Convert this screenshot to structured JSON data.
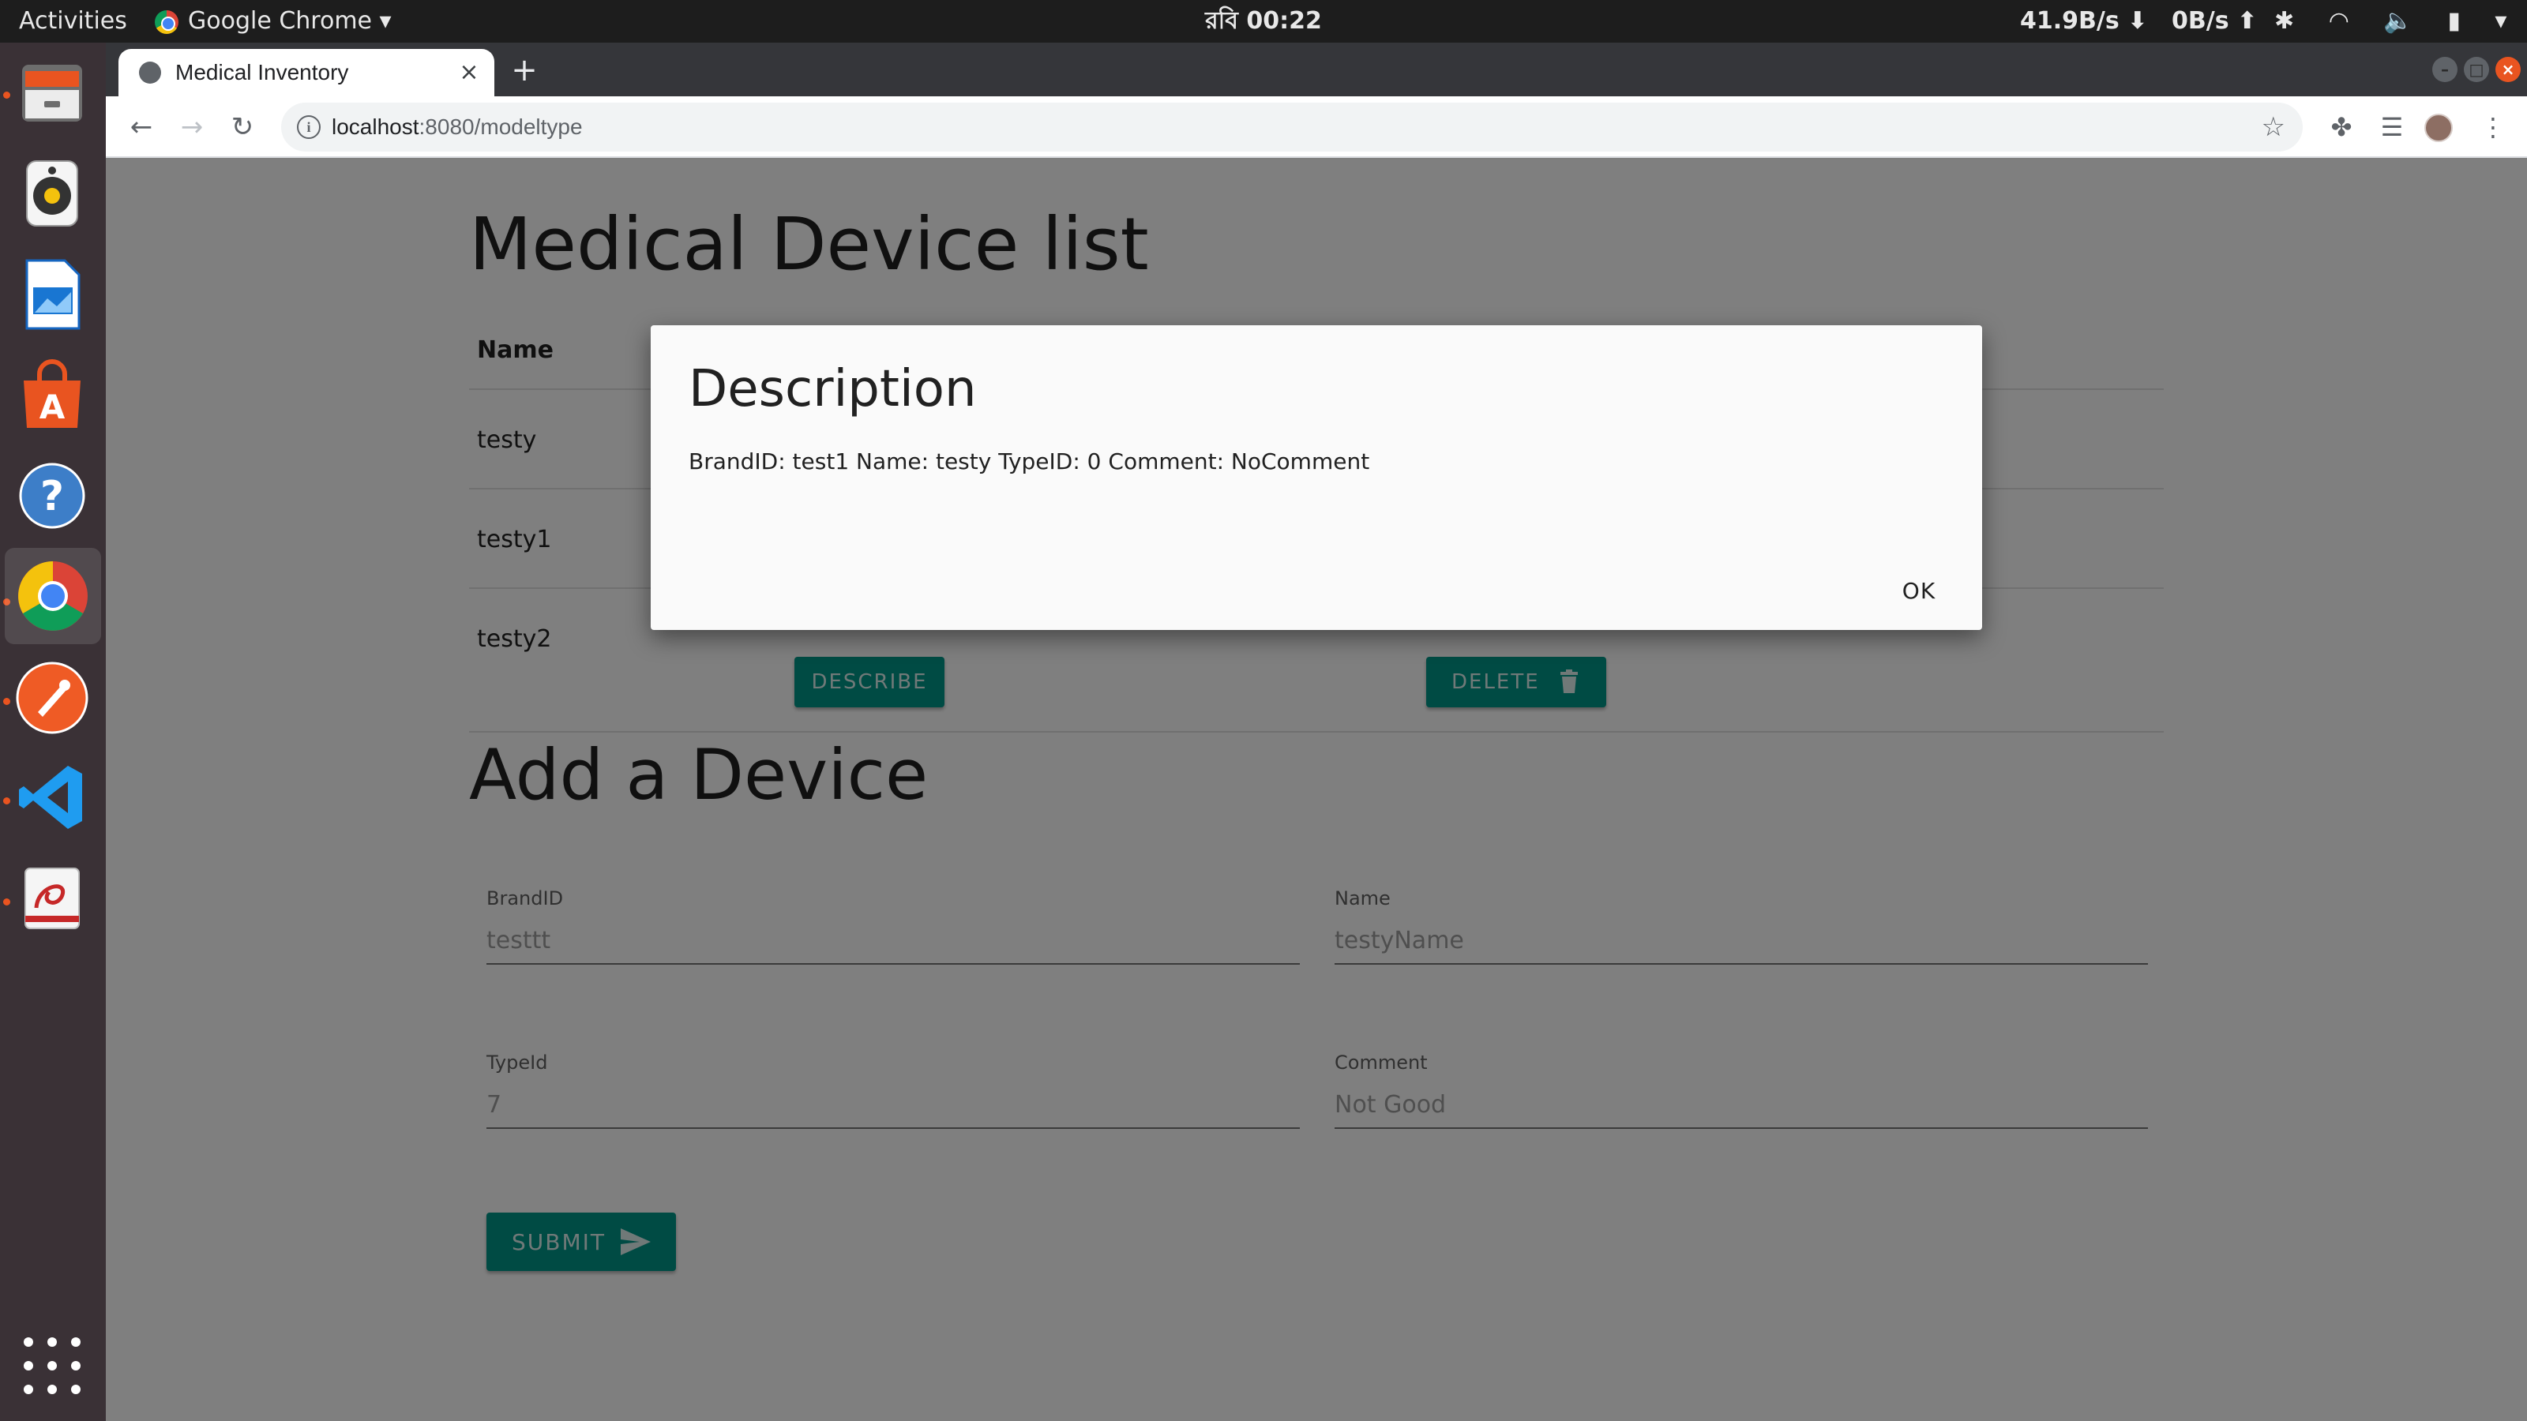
{
  "system_bar": {
    "activities": "Activities",
    "app_name": "Google Chrome",
    "clock": "রবি 00:22",
    "net_down": "41.9B/s ⬇",
    "net_up": "0B/s ⬆"
  },
  "dock": {
    "items": [
      "Files",
      "Rhythmbox",
      "LibreOffice Impress",
      "Ubuntu Software",
      "Help",
      "Google Chrome",
      "Postman",
      "Visual Studio Code",
      "Evince"
    ]
  },
  "browser": {
    "tab_title": "Medical Inventory",
    "tab_close": "×",
    "new_tab": "+",
    "url_host": "localhost",
    "url_path": ":8080/modeltype"
  },
  "page": {
    "heading": "Medical Device list",
    "column_name_header": "Name",
    "devices": [
      {
        "name": "testy"
      },
      {
        "name": "testy1"
      },
      {
        "name": "testy2"
      }
    ],
    "describe_label": "DESCRIBE",
    "delete_label": "DELETE",
    "form_heading": "Add a Device",
    "fields": {
      "brand": {
        "label": "BrandID",
        "placeholder": "testtt"
      },
      "name": {
        "label": "Name",
        "placeholder": "testyName"
      },
      "type": {
        "label": "TypeId",
        "placeholder": "7"
      },
      "comment": {
        "label": "Comment",
        "placeholder": "Not Good"
      }
    },
    "submit_label": "SUBMIT"
  },
  "dialog": {
    "title": "Description",
    "body": "BrandID: test1 Name: testy TypeID: 0 Comment: NoComment",
    "ok_label": "OK"
  },
  "colors": {
    "accent": "#009688",
    "ubuntu_orange": "#e95420"
  }
}
